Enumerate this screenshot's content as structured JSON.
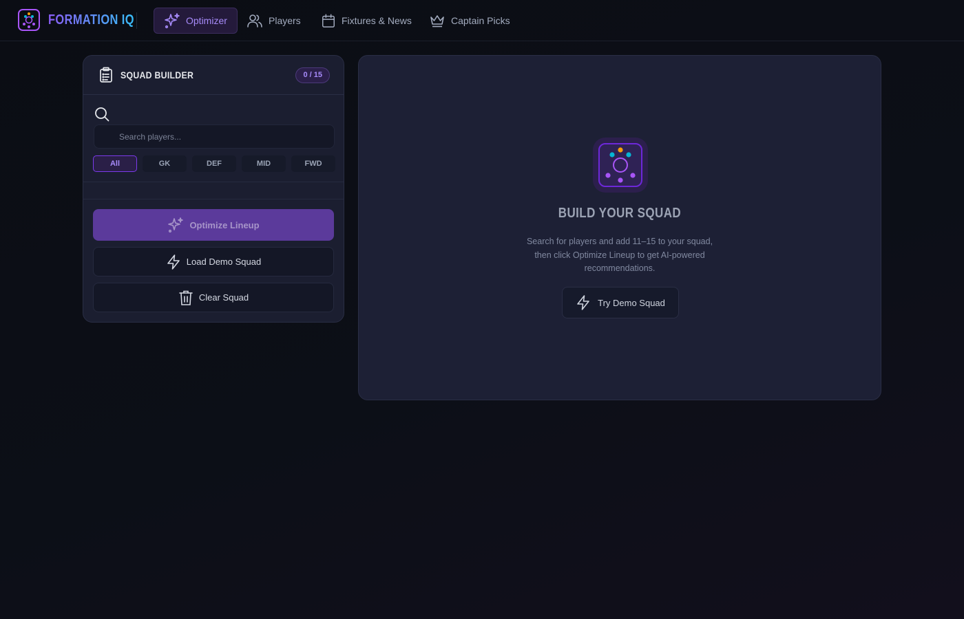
{
  "app": {
    "brand_name": "FORMATION IQ"
  },
  "nav": {
    "items": [
      {
        "label": "Optimizer",
        "icon": "sparkles-icon",
        "active": true
      },
      {
        "label": "Players",
        "icon": "users-icon",
        "active": false
      },
      {
        "label": "Fixtures & News",
        "icon": "calendar-icon",
        "active": false
      },
      {
        "label": "Captain Picks",
        "icon": "crown-icon",
        "active": false
      }
    ]
  },
  "squad_builder": {
    "title": "SQUAD BUILDER",
    "count": "0 / 15",
    "search_placeholder": "Search players...",
    "search_value": "",
    "filters": [
      "All",
      "GK",
      "DEF",
      "MID",
      "FWD"
    ],
    "active_filter": "All",
    "optimize_label": "Optimize Lineup",
    "load_demo_label": "Load Demo Squad",
    "clear_label": "Clear Squad"
  },
  "empty_state": {
    "title": "BUILD YOUR SQUAD",
    "description": "Search for players and add 11–15 to your squad, then click Optimize Lineup to get AI-powered recommendations.",
    "try_demo_label": "Try Demo Squad"
  },
  "colors": {
    "accent": "#a855f7",
    "accent_light": "#a78bfa",
    "brand_gradient_end": "#38bdf8",
    "panel_bg": "#1b1e30"
  }
}
